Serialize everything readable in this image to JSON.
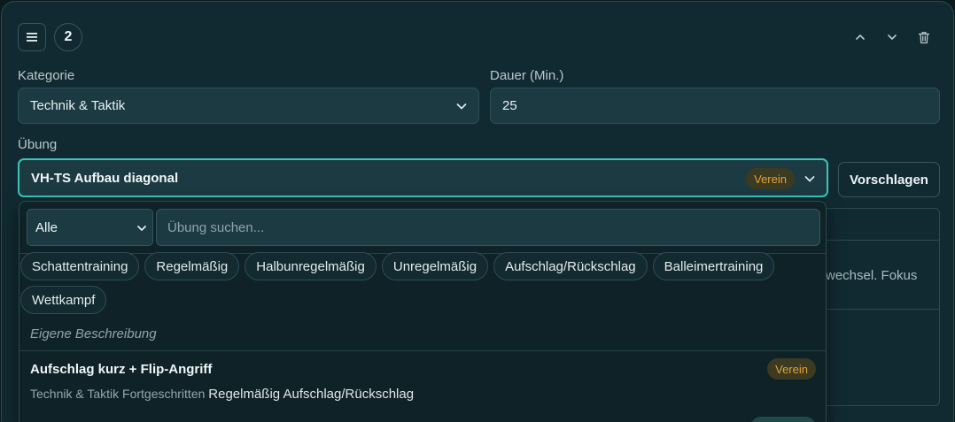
{
  "header": {
    "menu_icon": "hamburger-icon",
    "number": "2",
    "actions": [
      "chevron-up-icon",
      "chevron-down-icon",
      "trash-icon"
    ]
  },
  "form": {
    "kategorie_label": "Kategorie",
    "kategorie_value": "Technik & Taktik",
    "dauer_label": "Dauer (Min.)",
    "dauer_value": "25",
    "uebung_label": "Übung",
    "uebung_value": "VH-TS Aufbau diagonal",
    "uebung_badge": "Verein",
    "suggest_label": "Vorschlagen"
  },
  "background": {
    "partial_text": "wechsel. Fokus"
  },
  "dropdown": {
    "filter_value": "Alle",
    "search_placeholder": "Übung suchen...",
    "chips": [
      "Schattentraining",
      "Regelmäßig",
      "Halbunregelmäßig",
      "Unregelmäßig",
      "Aufschlag/Rückschlag",
      "Balleimertraining",
      "Wettkampf"
    ],
    "custom_description": "Eigene Beschreibung",
    "items": [
      {
        "title": "Aufschlag kurz + Flip-Angriff",
        "badge": "Verein",
        "category": "Technik & Taktik",
        "level": "Fortgeschritten",
        "tags": "Regelmäßig Aufschlag/Rückschlag"
      }
    ]
  },
  "colors": {
    "accent": "#3bc5b9",
    "badge_text": "#e0a431",
    "background": "#112a31"
  }
}
